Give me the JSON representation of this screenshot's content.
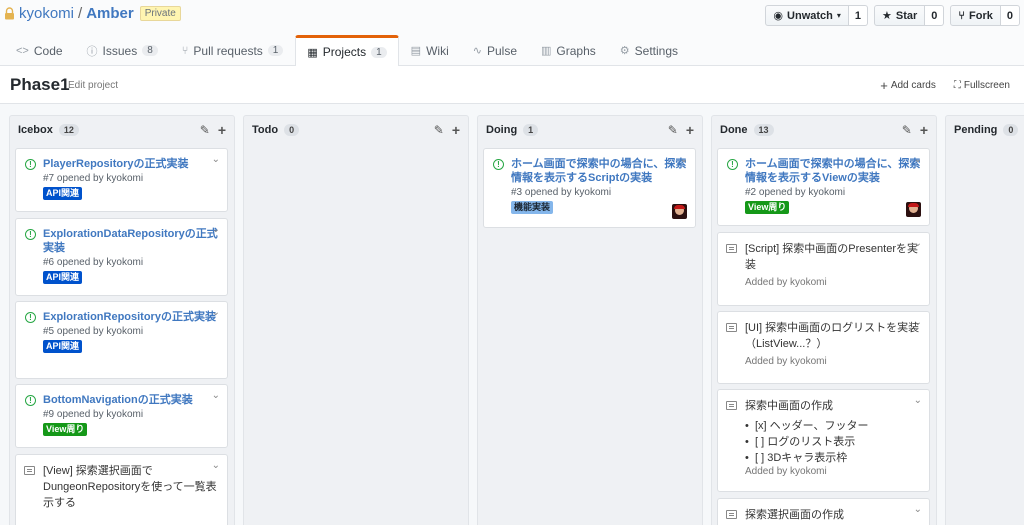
{
  "repo": {
    "owner": "kyokomi",
    "sep": "/",
    "name": "Amber",
    "badge": "Private"
  },
  "actions": {
    "unwatch": {
      "label": "Unwatch",
      "count": "1"
    },
    "star": {
      "label": "Star",
      "count": "0"
    },
    "fork": {
      "label": "Fork",
      "count": "0"
    }
  },
  "tabs": [
    {
      "icon": "<>",
      "label": "Code",
      "count": ""
    },
    {
      "icon": "ⓘ",
      "label": "Issues",
      "count": "8"
    },
    {
      "icon": "⑂",
      "label": "Pull requests",
      "count": "1"
    },
    {
      "icon": "▦",
      "label": "Projects",
      "count": "1",
      "selected": true
    },
    {
      "icon": "▤",
      "label": "Wiki",
      "count": ""
    },
    {
      "icon": "∿",
      "label": "Pulse",
      "count": ""
    },
    {
      "icon": "▥",
      "label": "Graphs",
      "count": ""
    },
    {
      "icon": "⚙",
      "label": "Settings",
      "count": ""
    }
  ],
  "project": {
    "name": "Phase1",
    "edit": "Edit project",
    "add_cards": "Add cards",
    "fullscreen": "Fullscreen"
  },
  "columns": [
    {
      "name": "Icebox",
      "count": "12"
    },
    {
      "name": "Todo",
      "count": "0"
    },
    {
      "name": "Doing",
      "count": "1"
    },
    {
      "name": "Done",
      "count": "13"
    },
    {
      "name": "Pending",
      "count": "0"
    }
  ],
  "cards": {
    "icebox": [
      {
        "title": "PlayerRepositoryの正式実装",
        "meta": "#7 opened by kyokomi",
        "label": "API関連",
        "label_color": "#0052cc"
      },
      {
        "title": "ExplorationDataRepositoryの正式実装",
        "meta": "#6 opened by kyokomi",
        "label": "API関連",
        "label_color": "#0052cc"
      },
      {
        "title": "ExplorationRepositoryの正式実装",
        "meta": "#5 opened by kyokomi",
        "label": "API関連",
        "label_color": "#0052cc"
      },
      {
        "title": "BottomNavigationの正式実装",
        "meta": "#9 opened by kyokomi",
        "label": "View周り",
        "label_color": "#159818"
      },
      {
        "note": "[View] 探索選択画面でDungeonRepositoryを使って一覧表示する"
      }
    ],
    "doing": [
      {
        "title": "ホーム画面で探索中の場合に、探索情報を表示するScriptの実装",
        "meta": "#3 opened by kyokomi",
        "label": "機能実装",
        "label_color": "#84b6eb"
      }
    ],
    "done": [
      {
        "title": "ホーム画面で探索中の場合に、探索情報を表示するViewの実装",
        "meta": "#2 opened by kyokomi",
        "label": "View周り",
        "label_color": "#159818"
      },
      {
        "note": "[Script] 探索中画面のPresenterを実装",
        "added": "Added by kyokomi"
      },
      {
        "note": "[UI] 探索中画面のログリストを実装（ListView...？）",
        "added": "Added by kyokomi"
      },
      {
        "note": "探索中画面の作成",
        "items": [
          "[x] ヘッダー、フッター",
          "[ ] ログのリスト表示",
          "[ ] 3Dキャラ表示枠"
        ],
        "added": "Added by kyokomi"
      },
      {
        "note": "探索選択画面の作成"
      }
    ]
  }
}
